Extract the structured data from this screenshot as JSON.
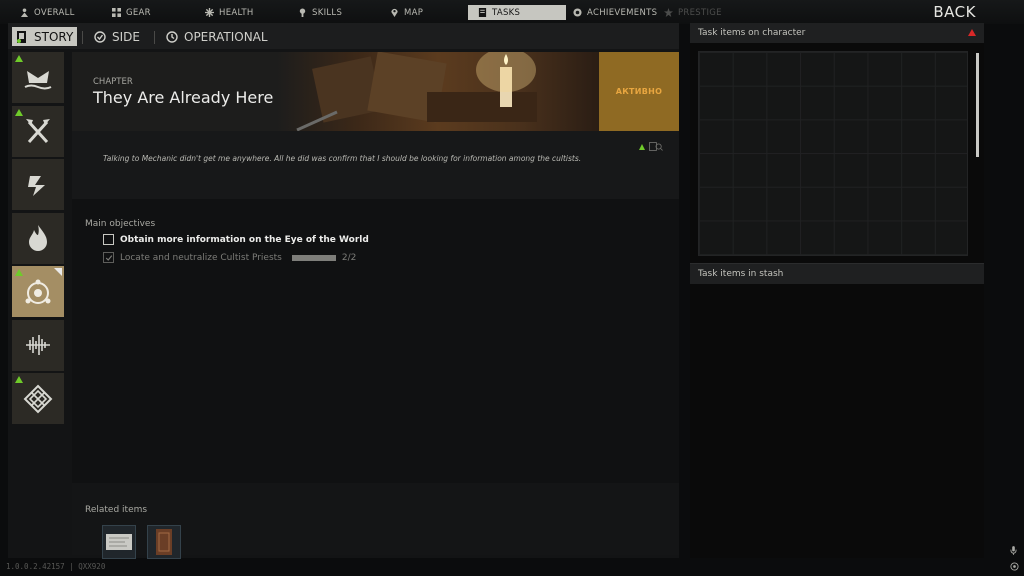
{
  "topnav": {
    "tabs": [
      {
        "label": "OVERALL",
        "icon": "person-icon"
      },
      {
        "label": "GEAR",
        "icon": "gear-grid-icon"
      },
      {
        "label": "HEALTH",
        "icon": "health-icon"
      },
      {
        "label": "SKILLS",
        "icon": "skills-icon"
      },
      {
        "label": "MAP",
        "icon": "map-pin-icon"
      },
      {
        "label": "TASKS",
        "icon": "tasks-icon"
      },
      {
        "label": "ACHIEVEMENTS",
        "icon": "achievement-icon"
      },
      {
        "label": "PRESTIGE",
        "icon": "prestige-icon"
      }
    ],
    "active": "TASKS",
    "back_label": "BACK"
  },
  "subtabs": [
    {
      "label": "STORY"
    },
    {
      "label": "SIDE"
    },
    {
      "label": "OPERATIONAL"
    }
  ],
  "task": {
    "chapter_label": "CHAPTER",
    "title": "They Are Already Here",
    "status": "АКТИВНО",
    "description": "Talking to Mechanic didn't get me anywhere. All he did was confirm that I should be looking for information among the cultists.",
    "objectives_header": "Main objectives",
    "objectives": [
      {
        "text": "Obtain more information on the Eye of the World",
        "done": false
      },
      {
        "text": "Locate and neutralize Cultist Priests",
        "done": true,
        "progress": "2/2",
        "progress_fraction": 1.0
      }
    ],
    "related_header": "Related items"
  },
  "right_panel": {
    "character_header": "Task items on character",
    "stash_header": "Task items in stash"
  },
  "version": "1.0.0.2.42157 | QXX920",
  "colors": {
    "accent_new": "#6fcb2a",
    "warning": "#d82828",
    "status_orange": "#e8a640",
    "selected_category": "#a48e64"
  }
}
